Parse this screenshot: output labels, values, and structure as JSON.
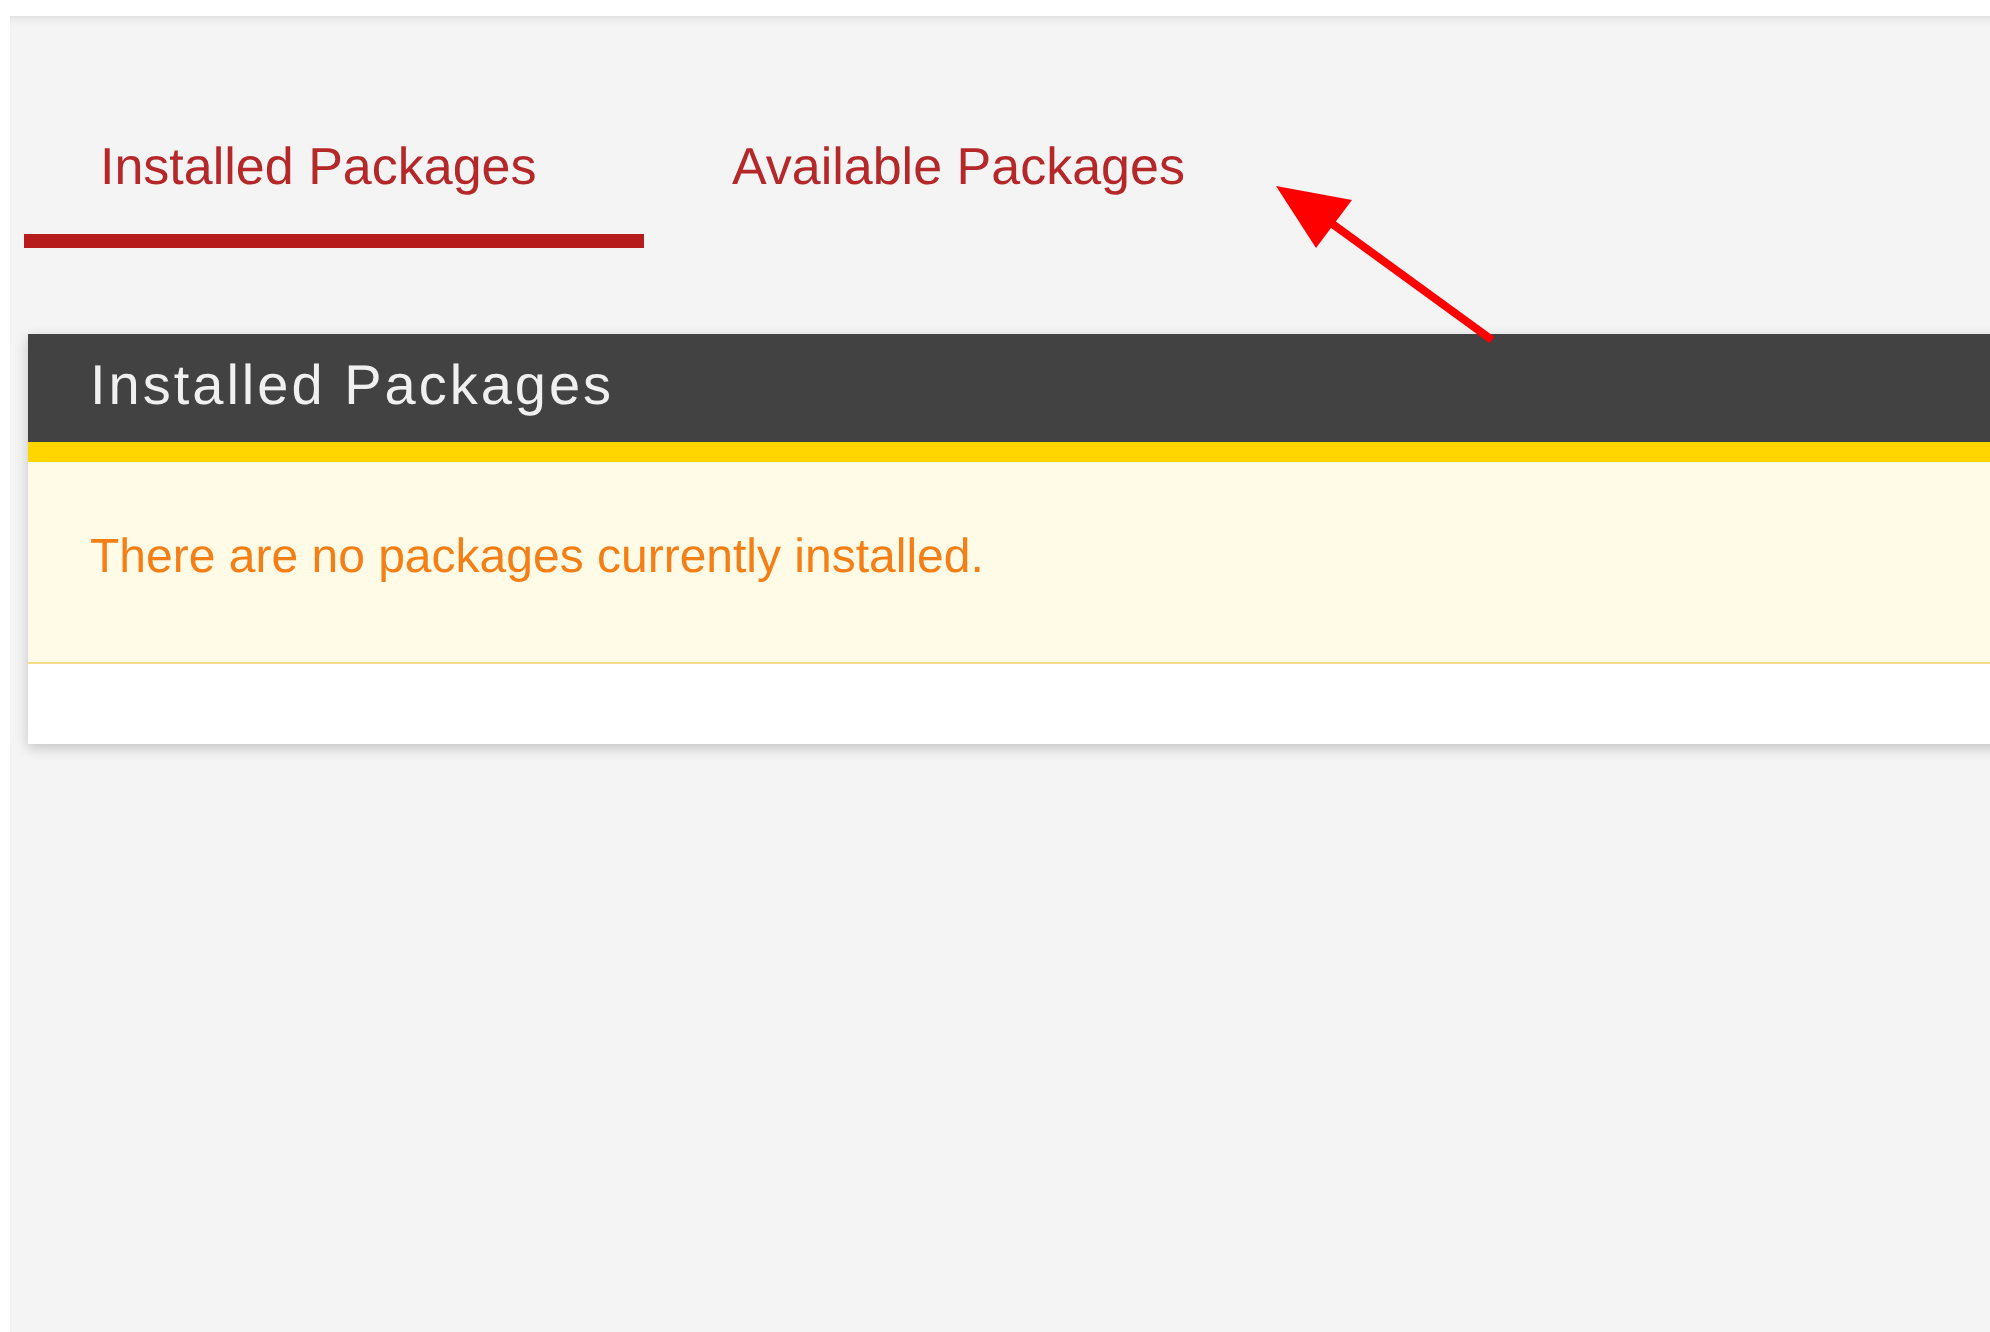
{
  "tabs": [
    {
      "label": "Installed Packages",
      "selected": true
    },
    {
      "label": "Available Packages",
      "selected": false
    }
  ],
  "panel": {
    "title": "Installed Packages",
    "message": "There are no packages currently installed."
  }
}
